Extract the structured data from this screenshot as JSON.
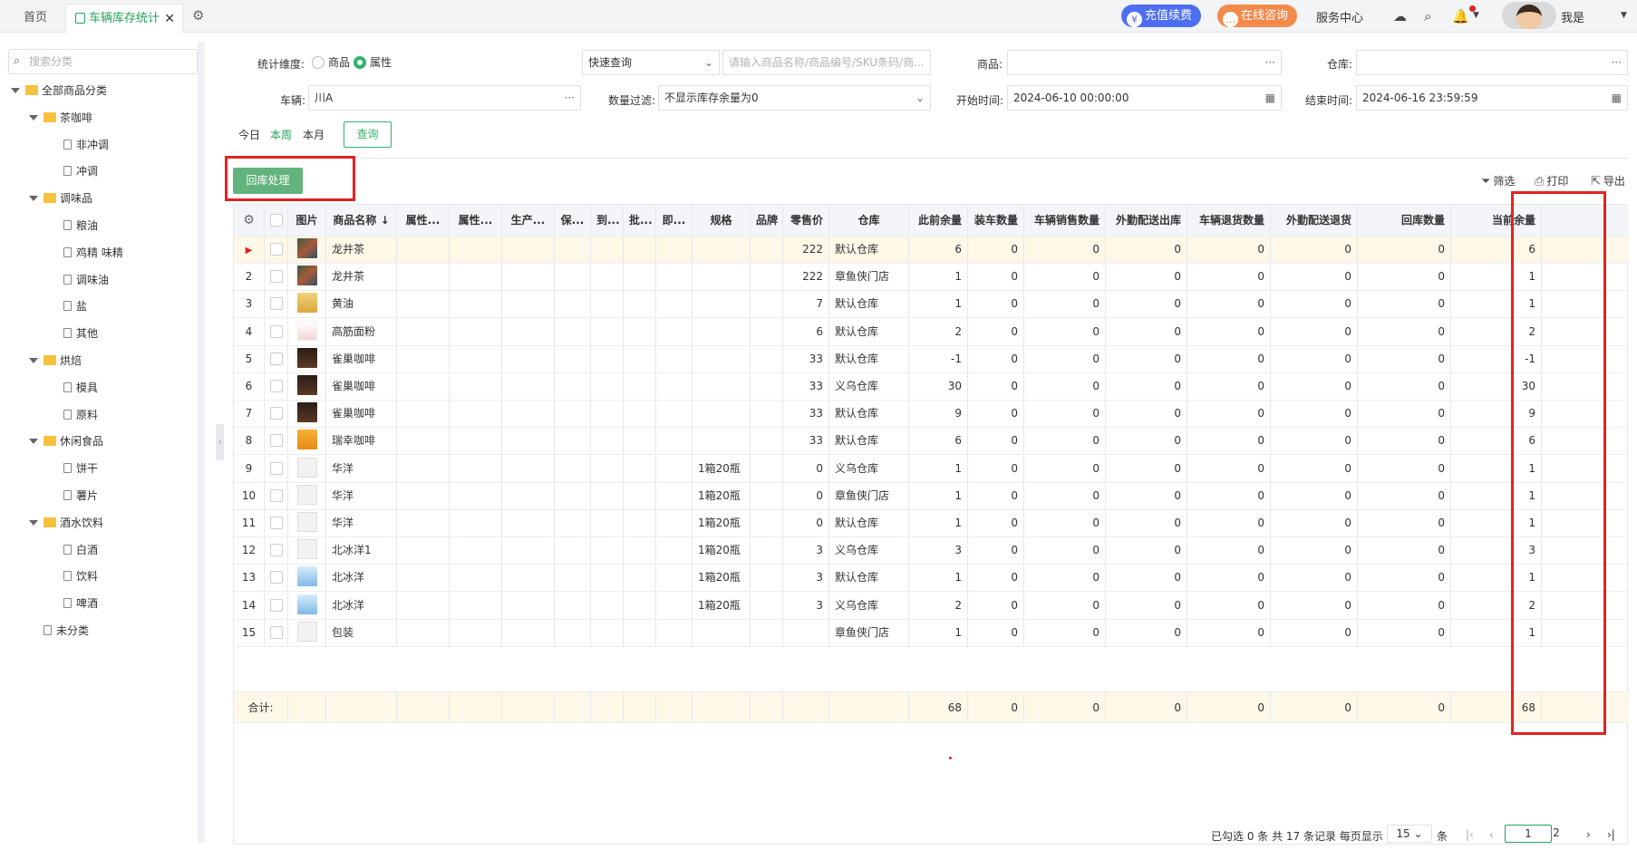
{
  "topbar": {
    "tabs": [
      {
        "label": "首页"
      },
      {
        "label": "车辆库存统计"
      }
    ],
    "recharge_label": "充值续费",
    "consult_label": "在线咨询",
    "service_label": "服务中心",
    "user_label": "我是",
    "accent_color": "#22a35a"
  },
  "sidebar": {
    "search_placeholder": "搜索分类",
    "tree": [
      {
        "label": "全部商品分类",
        "level": 0,
        "type": "folder"
      },
      {
        "label": "茶咖啡",
        "level": 1,
        "type": "folder"
      },
      {
        "label": "非冲调",
        "level": 2,
        "type": "file"
      },
      {
        "label": "冲调",
        "level": 2,
        "type": "file"
      },
      {
        "label": "调味品",
        "level": 1,
        "type": "folder"
      },
      {
        "label": "粮油",
        "level": 2,
        "type": "file"
      },
      {
        "label": "鸡精 味精",
        "level": 2,
        "type": "file"
      },
      {
        "label": "调味油",
        "level": 2,
        "type": "file"
      },
      {
        "label": "盐",
        "level": 2,
        "type": "file"
      },
      {
        "label": "其他",
        "level": 2,
        "type": "file"
      },
      {
        "label": "烘焙",
        "level": 1,
        "type": "folder"
      },
      {
        "label": "模具",
        "level": 2,
        "type": "file"
      },
      {
        "label": "原料",
        "level": 2,
        "type": "file"
      },
      {
        "label": "休闲食品",
        "level": 1,
        "type": "folder"
      },
      {
        "label": "饼干",
        "level": 2,
        "type": "file"
      },
      {
        "label": "薯片",
        "level": 2,
        "type": "file"
      },
      {
        "label": "酒水饮料",
        "level": 1,
        "type": "folder"
      },
      {
        "label": "白酒",
        "level": 2,
        "type": "file"
      },
      {
        "label": "饮料",
        "level": 2,
        "type": "file"
      },
      {
        "label": "啤酒",
        "level": 2,
        "type": "file"
      },
      {
        "label": "未分类",
        "level": 1,
        "type": "file"
      }
    ]
  },
  "filters": {
    "dimension_label": "统计维度:",
    "dimension_options": [
      "商品",
      "属性"
    ],
    "dimension_selected": "属性",
    "quick_query": "快速查询",
    "product_search_placeholder": "请输入商品名称/商品编号/SKU条码/商...",
    "product_label": "商品:",
    "warehouse_label": "仓库:",
    "vehicle_label": "车辆:",
    "vehicle_value": "川A",
    "qty_filter_label": "数量过滤:",
    "qty_filter_value": "不显示库存余量为0",
    "start_label": "开始时间:",
    "start_value": "2024-06-10 00:00:00",
    "end_label": "结束时间:",
    "end_value": "2024-06-16 23:59:59",
    "quick_dates": [
      "今日",
      "本周",
      "本月"
    ],
    "quick_selected": "本周",
    "query_button": "查询"
  },
  "toolbar": {
    "return_button": "回库处理",
    "filter_label": "筛选",
    "print_label": "打印",
    "export_label": "导出"
  },
  "table": {
    "columns": [
      "图片",
      "商品名称",
      "属性...",
      "属性...",
      "生产...",
      "保...",
      "到...",
      "批...",
      "即...",
      "规格",
      "品牌",
      "零售价",
      "仓库",
      "此前余量",
      "装车数量",
      "车辆销售数量",
      "外勤配送出库",
      "车辆退货数量",
      "外勤配送退货",
      "回库数量",
      "当前余量"
    ],
    "rows": [
      {
        "no": "1",
        "img": "tea",
        "name": "龙井茶",
        "spec": "",
        "price": "222",
        "warehouse": "默认仓库",
        "prev": "6",
        "load": "0",
        "sale": "0",
        "out": "0",
        "ret": "0",
        "dret": "0",
        "back": "0",
        "cur": "6"
      },
      {
        "no": "2",
        "img": "tea",
        "name": "龙井茶",
        "spec": "",
        "price": "222",
        "warehouse": "章鱼侠门店",
        "prev": "1",
        "load": "0",
        "sale": "0",
        "out": "0",
        "ret": "0",
        "dret": "0",
        "back": "0",
        "cur": "1"
      },
      {
        "no": "3",
        "img": "oil",
        "name": "黄油",
        "spec": "",
        "price": "7",
        "warehouse": "默认仓库",
        "prev": "1",
        "load": "0",
        "sale": "0",
        "out": "0",
        "ret": "0",
        "dret": "0",
        "back": "0",
        "cur": "1"
      },
      {
        "no": "4",
        "img": "flour",
        "name": "高筋面粉",
        "spec": "",
        "price": "6",
        "warehouse": "默认仓库",
        "prev": "2",
        "load": "0",
        "sale": "0",
        "out": "0",
        "ret": "0",
        "dret": "0",
        "back": "0",
        "cur": "2"
      },
      {
        "no": "5",
        "img": "coffee",
        "name": "雀巢咖啡",
        "spec": "",
        "price": "33",
        "warehouse": "默认仓库",
        "prev": "-1",
        "load": "0",
        "sale": "0",
        "out": "0",
        "ret": "0",
        "dret": "0",
        "back": "0",
        "cur": "-1"
      },
      {
        "no": "6",
        "img": "coffee",
        "name": "雀巢咖啡",
        "spec": "",
        "price": "33",
        "warehouse": "义乌仓库",
        "prev": "30",
        "load": "0",
        "sale": "0",
        "out": "0",
        "ret": "0",
        "dret": "0",
        "back": "0",
        "cur": "30"
      },
      {
        "no": "7",
        "img": "coffee",
        "name": "雀巢咖啡",
        "spec": "",
        "price": "33",
        "warehouse": "默认仓库",
        "prev": "9",
        "load": "0",
        "sale": "0",
        "out": "0",
        "ret": "0",
        "dret": "0",
        "back": "0",
        "cur": "9"
      },
      {
        "no": "8",
        "img": "lucky",
        "name": "瑞幸咖啡",
        "spec": "",
        "price": "33",
        "warehouse": "默认仓库",
        "prev": "6",
        "load": "0",
        "sale": "0",
        "out": "0",
        "ret": "0",
        "dret": "0",
        "back": "0",
        "cur": "6"
      },
      {
        "no": "9",
        "img": "none",
        "name": "华洋",
        "spec": "1箱20瓶",
        "price": "0",
        "warehouse": "义乌仓库",
        "prev": "1",
        "load": "0",
        "sale": "0",
        "out": "0",
        "ret": "0",
        "dret": "0",
        "back": "0",
        "cur": "1"
      },
      {
        "no": "10",
        "img": "none",
        "name": "华洋",
        "spec": "1箱20瓶",
        "price": "0",
        "warehouse": "章鱼侠门店",
        "prev": "1",
        "load": "0",
        "sale": "0",
        "out": "0",
        "ret": "0",
        "dret": "0",
        "back": "0",
        "cur": "1"
      },
      {
        "no": "11",
        "img": "none",
        "name": "华洋",
        "spec": "1箱20瓶",
        "price": "0",
        "warehouse": "默认仓库",
        "prev": "1",
        "load": "0",
        "sale": "0",
        "out": "0",
        "ret": "0",
        "dret": "0",
        "back": "0",
        "cur": "1"
      },
      {
        "no": "12",
        "img": "none",
        "name": "北冰洋1",
        "spec": "1箱20瓶",
        "price": "3",
        "warehouse": "义乌仓库",
        "prev": "3",
        "load": "0",
        "sale": "0",
        "out": "0",
        "ret": "0",
        "dret": "0",
        "back": "0",
        "cur": "3"
      },
      {
        "no": "13",
        "img": "ice",
        "name": "北冰洋",
        "spec": "1箱20瓶",
        "price": "3",
        "warehouse": "默认仓库",
        "prev": "1",
        "load": "0",
        "sale": "0",
        "out": "0",
        "ret": "0",
        "dret": "0",
        "back": "0",
        "cur": "1"
      },
      {
        "no": "14",
        "img": "ice",
        "name": "北冰洋",
        "spec": "1箱20瓶",
        "price": "3",
        "warehouse": "义乌仓库",
        "prev": "2",
        "load": "0",
        "sale": "0",
        "out": "0",
        "ret": "0",
        "dret": "0",
        "back": "0",
        "cur": "2"
      },
      {
        "no": "15",
        "img": "none",
        "name": "包装",
        "spec": "",
        "price": "",
        "warehouse": "章鱼侠门店",
        "prev": "1",
        "load": "0",
        "sale": "0",
        "out": "0",
        "ret": "0",
        "dret": "0",
        "back": "0",
        "cur": "1"
      }
    ],
    "summary": {
      "label": "合计:",
      "prev": "68",
      "load": "0",
      "sale": "0",
      "out": "0",
      "ret": "0",
      "dret": "0",
      "back": "0",
      "cur": "68"
    }
  },
  "pager": {
    "info": "已勾选 0 条 共 17 条记录 每页显示",
    "page_size": "15",
    "unit": "条",
    "pages": [
      "1",
      "2"
    ]
  }
}
